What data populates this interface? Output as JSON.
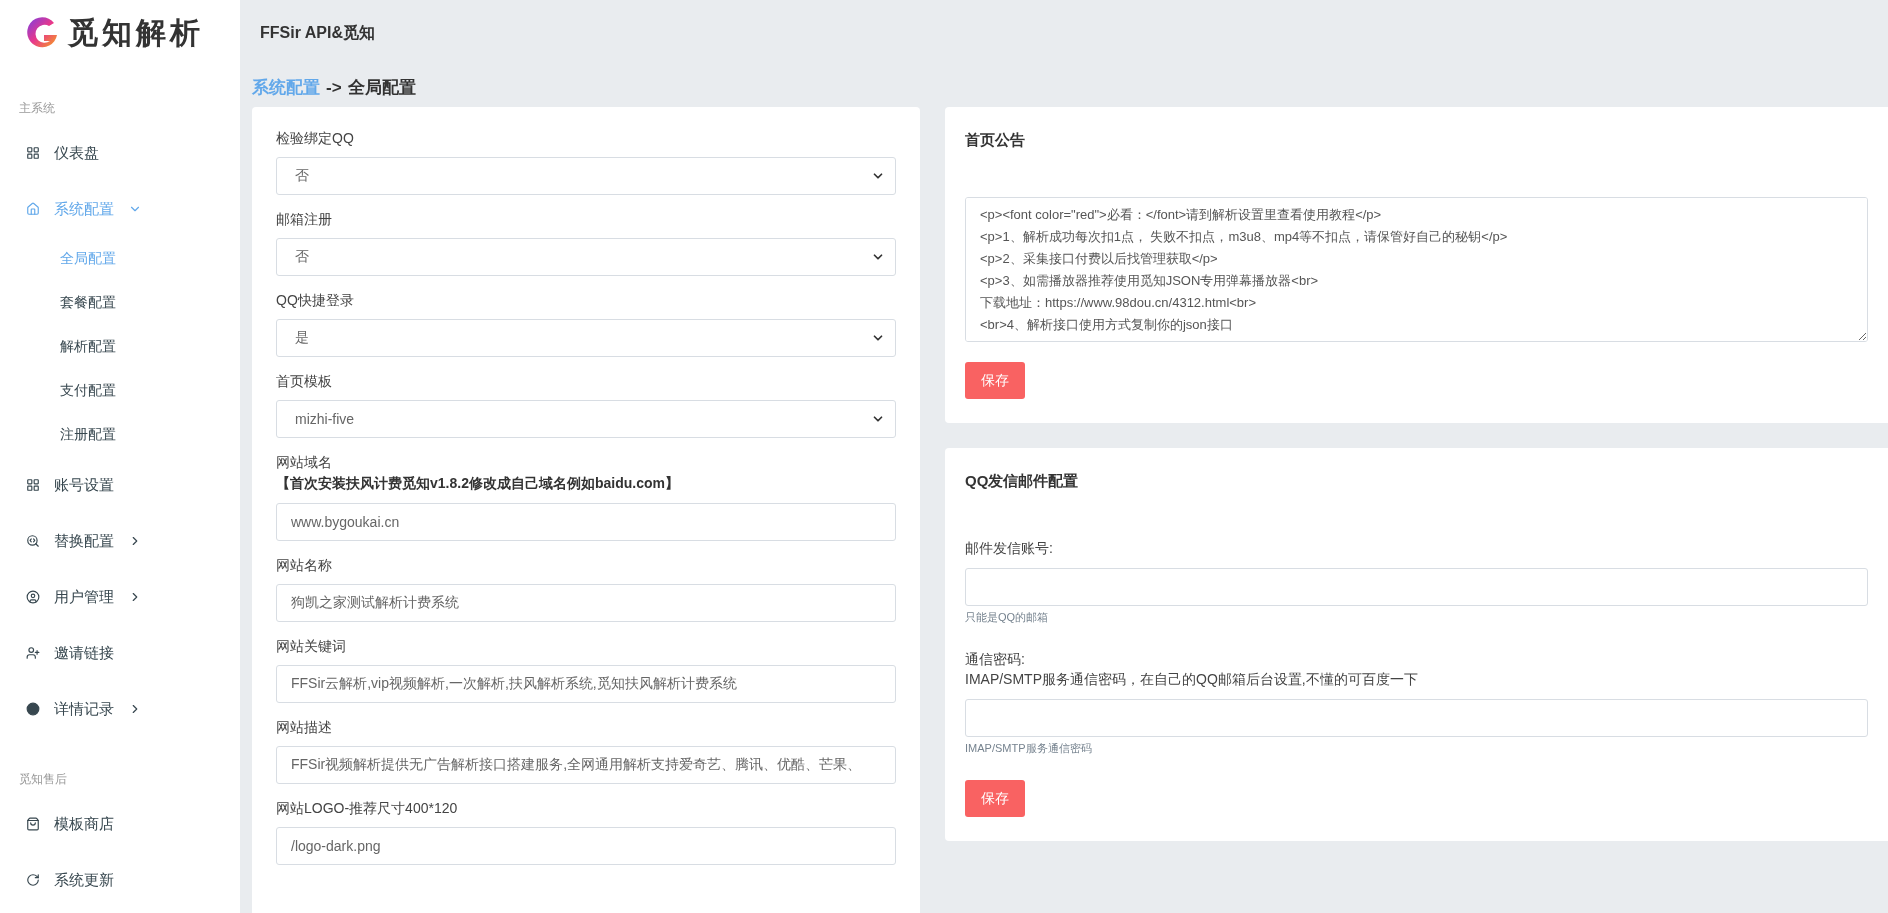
{
  "sidebar": {
    "logo_text": "觅知解析",
    "sections": [
      {
        "label": "主系统",
        "items": [
          {
            "label": "仪表盘",
            "selected": false
          },
          {
            "label": "系统配置",
            "selected": true,
            "expanded": true,
            "children": [
              {
                "label": "全局配置",
                "selected": true
              },
              {
                "label": "套餐配置",
                "selected": false
              },
              {
                "label": "解析配置",
                "selected": false
              },
              {
                "label": "支付配置",
                "selected": false
              },
              {
                "label": "注册配置",
                "selected": false
              }
            ]
          },
          {
            "label": "账号设置",
            "selected": false
          },
          {
            "label": "替换配置",
            "selected": false,
            "expanded": false
          },
          {
            "label": "用户管理",
            "selected": false,
            "expanded": false
          },
          {
            "label": "邀请链接",
            "selected": false
          },
          {
            "label": "详情记录",
            "selected": false,
            "expanded": false
          }
        ]
      },
      {
        "label": "觅知售后",
        "items": [
          {
            "label": "模板商店",
            "selected": false
          },
          {
            "label": "系统更新",
            "selected": false
          }
        ]
      }
    ]
  },
  "topbar": {
    "title": "FFSir API&觅知"
  },
  "breadcrumb": {
    "parent": "系统配置",
    "separator": "->",
    "current": "全局配置"
  },
  "global_form": {
    "fields": [
      {
        "kind": "select",
        "label": "检验绑定QQ",
        "value": "否"
      },
      {
        "kind": "select",
        "label": "邮箱注册",
        "value": "否"
      },
      {
        "kind": "select",
        "label": "QQ快捷登录",
        "value": "是"
      },
      {
        "kind": "select",
        "label": "首页模板",
        "value": "mizhi-five"
      },
      {
        "kind": "input",
        "label": "网站域名",
        "note": "【首次安装扶风计费觅知v1.8.2修改成自己域名例如baidu.com】",
        "value": "www.bygoukai.cn"
      },
      {
        "kind": "input",
        "label": "网站名称",
        "value": "狗凯之家测试解析计费系统"
      },
      {
        "kind": "input",
        "label": "网站关键词",
        "value": "FFSir云解析,vip视频解析,一次解析,扶风解析系统,觅知扶风解析计费系统"
      },
      {
        "kind": "input",
        "label": "网站描述",
        "value": "FFSir视频解析提供无广告解析接口搭建服务,全网通用解析支持爱奇艺、腾讯、优酷、芒果、"
      },
      {
        "kind": "input",
        "label": "网站LOGO-推荐尺寸400*120",
        "value": "/logo-dark.png"
      }
    ]
  },
  "notice_card": {
    "title": "首页公告",
    "content": "<p><font color=\"red\">必看：</font>请到解析设置里查看使用教程</p>\n<p>1、解析成功每次扣1点， 失败不扣点，m3u8、mp4等不扣点，请保管好自己的秘钥</p>\n<p>2、采集接口付费以后找管理获取</p>\n<p>3、如需播放器推荐使用觅知JSON专用弹幕播放器<br>\n下载地址：https://www.98dou.cn/4312.html<br>\n<br>4、解析接口使用方式复制你的json接口",
    "button": "保存"
  },
  "mail_card": {
    "title": "QQ发信邮件配置",
    "fields": [
      {
        "label": "邮件发信账号:",
        "help": "只能是QQ的邮箱"
      },
      {
        "label": "通信密码:",
        "note": "IMAP/SMTP服务通信密码，在自己的QQ邮箱后台设置,不懂的可百度一下",
        "help": "IMAP/SMTP服务通信密码"
      }
    ],
    "button": "保存"
  }
}
